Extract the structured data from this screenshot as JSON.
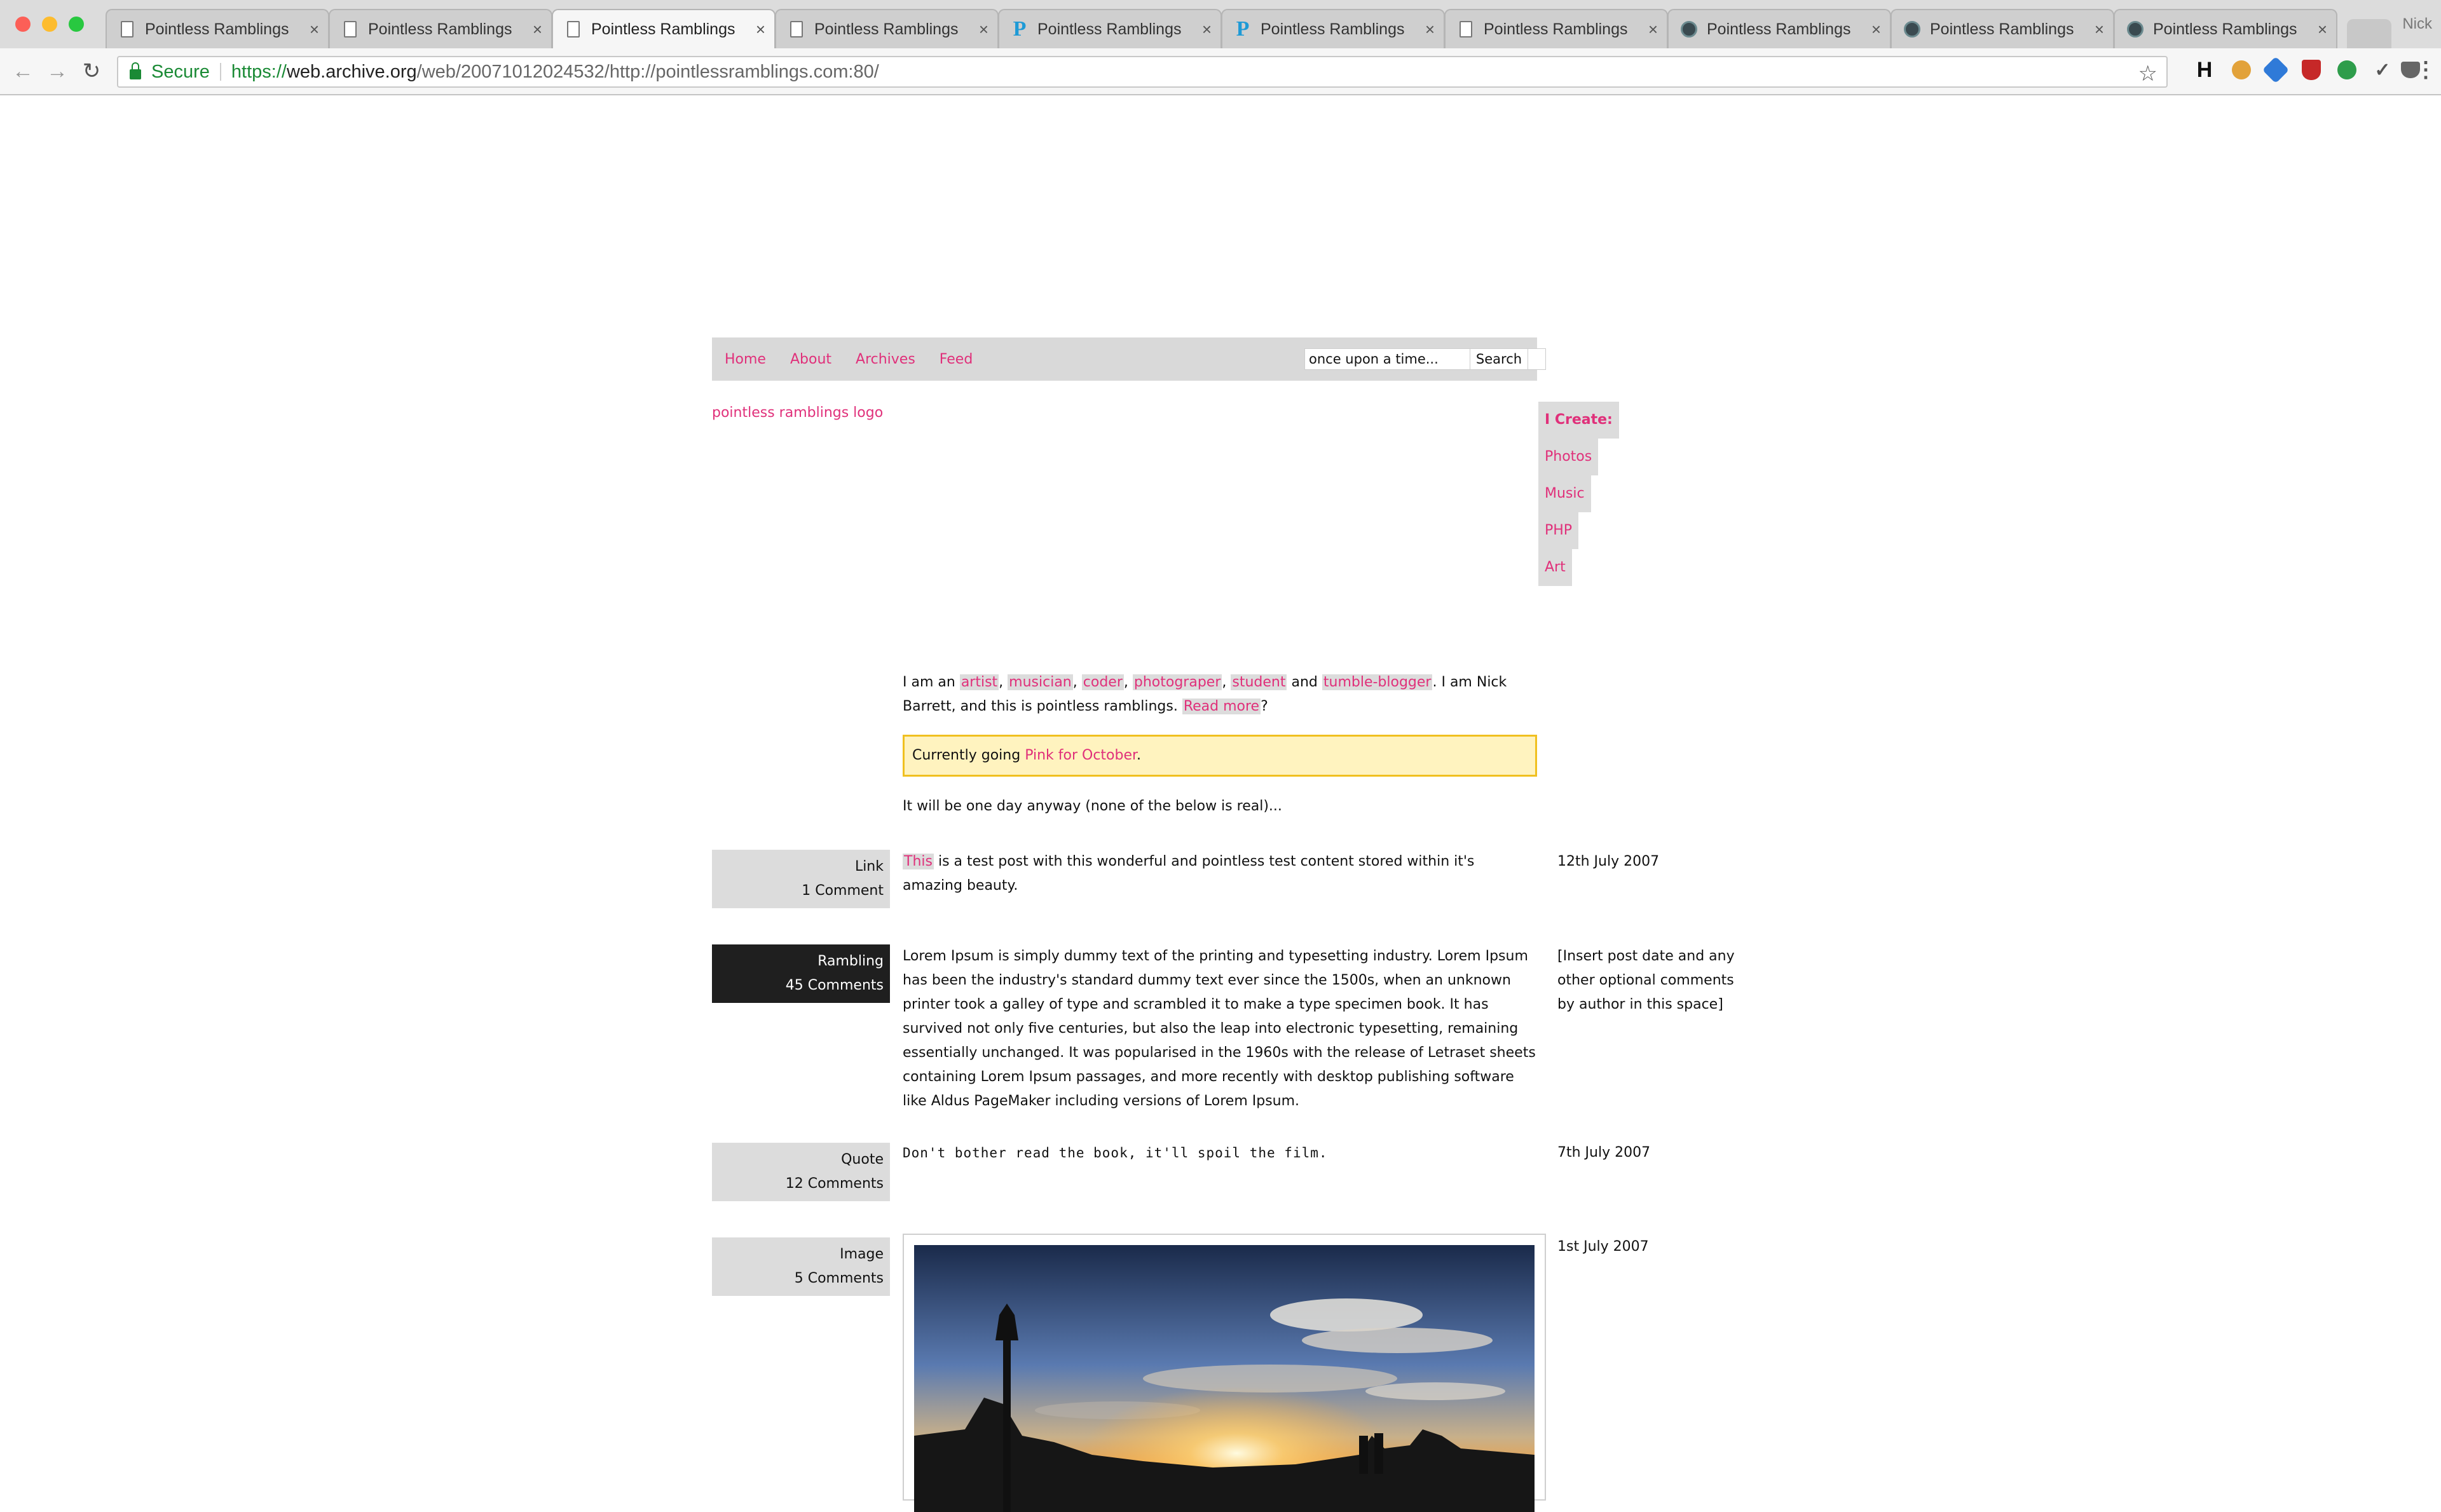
{
  "browser": {
    "tabs": [
      {
        "title": "Pointless Ramblings",
        "favicon": "doc",
        "active": false
      },
      {
        "title": "Pointless Ramblings",
        "favicon": "doc",
        "active": false
      },
      {
        "title": "Pointless Ramblings",
        "favicon": "doc",
        "active": true
      },
      {
        "title": "Pointless Ramblings",
        "favicon": "doc",
        "active": false
      },
      {
        "title": "Pointless Ramblings",
        "favicon": "p",
        "active": false
      },
      {
        "title": "Pointless Ramblings",
        "favicon": "p",
        "active": false
      },
      {
        "title": "Pointless Ramblings",
        "favicon": "doc",
        "active": false
      },
      {
        "title": "Pointless Ramblings",
        "favicon": "dark",
        "active": false
      },
      {
        "title": "Pointless Ramblings",
        "favicon": "dark",
        "active": false
      },
      {
        "title": "Pointless Ramblings",
        "favicon": "dark",
        "active": false
      }
    ],
    "profile_name": "Nick",
    "secure_label": "Secure",
    "url_scheme": "https://",
    "url_host": "web.archive.org",
    "url_path": "/web/20071012024532/http://pointlessramblings.com:80/",
    "extensions": [
      "H",
      "cookie",
      "link",
      "shield",
      "badge",
      "check",
      "pocket"
    ]
  },
  "site": {
    "nav": [
      {
        "label": "Home"
      },
      {
        "label": "About"
      },
      {
        "label": "Archives"
      },
      {
        "label": "Feed"
      }
    ],
    "search": {
      "value": "once upon a time...",
      "button": "Search"
    },
    "logo_alt": "pointless ramblings logo",
    "create": {
      "heading": "I Create:",
      "items": [
        "Photos",
        "Music",
        "PHP",
        "Art"
      ]
    },
    "intro": {
      "prefix": "I am an ",
      "links": [
        "artist",
        "musician",
        "coder",
        "photograper",
        "student",
        "tumble-blogger"
      ],
      "and": " and ",
      "mid": ". I am Nick Barrett, and this is pointless ramblings. ",
      "read_more": "Read more",
      "suffix": "?"
    },
    "notice": {
      "text": "Currently going ",
      "link": "Pink for October",
      "end": "."
    },
    "disclaimer": "It will be one day anyway (none of the below is real)...",
    "posts": [
      {
        "type": "Link",
        "comments": "1 Comment",
        "link_word": "This",
        "body": " is a test post with this wonderful and pointless test content stored within it's amazing beauty.",
        "date": "12th July 2007"
      },
      {
        "type": "Rambling",
        "comments": "45 Comments",
        "body": "Lorem Ipsum is simply dummy text of the printing and typesetting industry. Lorem Ipsum has been the industry's standard dummy text ever since the 1500s, when an unknown printer took a galley of type and scrambled it to make a type specimen book. It has survived not only five centuries, but also the leap into electronic typesetting, remaining essentially unchanged. It was popularised in the 1960s with the release of Letraset sheets containing Lorem Ipsum passages, and more recently with desktop publishing software like Aldus PageMaker including versions of Lorem Ipsum.",
        "date": "[Insert post date and any other optional comments by author in this space]"
      },
      {
        "type": "Quote",
        "comments": "12 Comments",
        "body": "Don't bother read the book, it'll spoil the film.",
        "date": "7th July 2007"
      },
      {
        "type": "Image",
        "comments": "5 Comments",
        "date": "1st July 2007"
      }
    ]
  },
  "colors": {
    "link": "#e0307a",
    "nav_bg": "#d9d9d9",
    "label_bg": "#dcdcdc",
    "dark_label_bg": "#1f1f1f",
    "notice_bg": "#fff3bf",
    "notice_border": "#f0c020",
    "secure_green": "#1a8a35"
  }
}
